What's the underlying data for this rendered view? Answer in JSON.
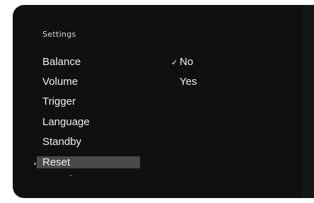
{
  "settings": {
    "title": "Settings",
    "menu_items": [
      {
        "label": "Balance"
      },
      {
        "label": "Volume"
      },
      {
        "label": "Trigger"
      },
      {
        "label": "Language"
      },
      {
        "label": "Standby"
      },
      {
        "label": "Reset"
      }
    ],
    "selected_item": "Reset"
  },
  "options": {
    "items": [
      {
        "label": "No",
        "checked": true
      },
      {
        "label": "Yes",
        "checked": false
      }
    ],
    "check_glyph": "✓"
  },
  "icons": {
    "checkmark": "checkmark-icon",
    "scroll_down": "chevron-down-icon",
    "cursor": "cursor-dot-icon"
  },
  "colors": {
    "screen_background": "#101010",
    "text": "#f0f0f0",
    "selection_highlight": "#4a4a4a"
  }
}
